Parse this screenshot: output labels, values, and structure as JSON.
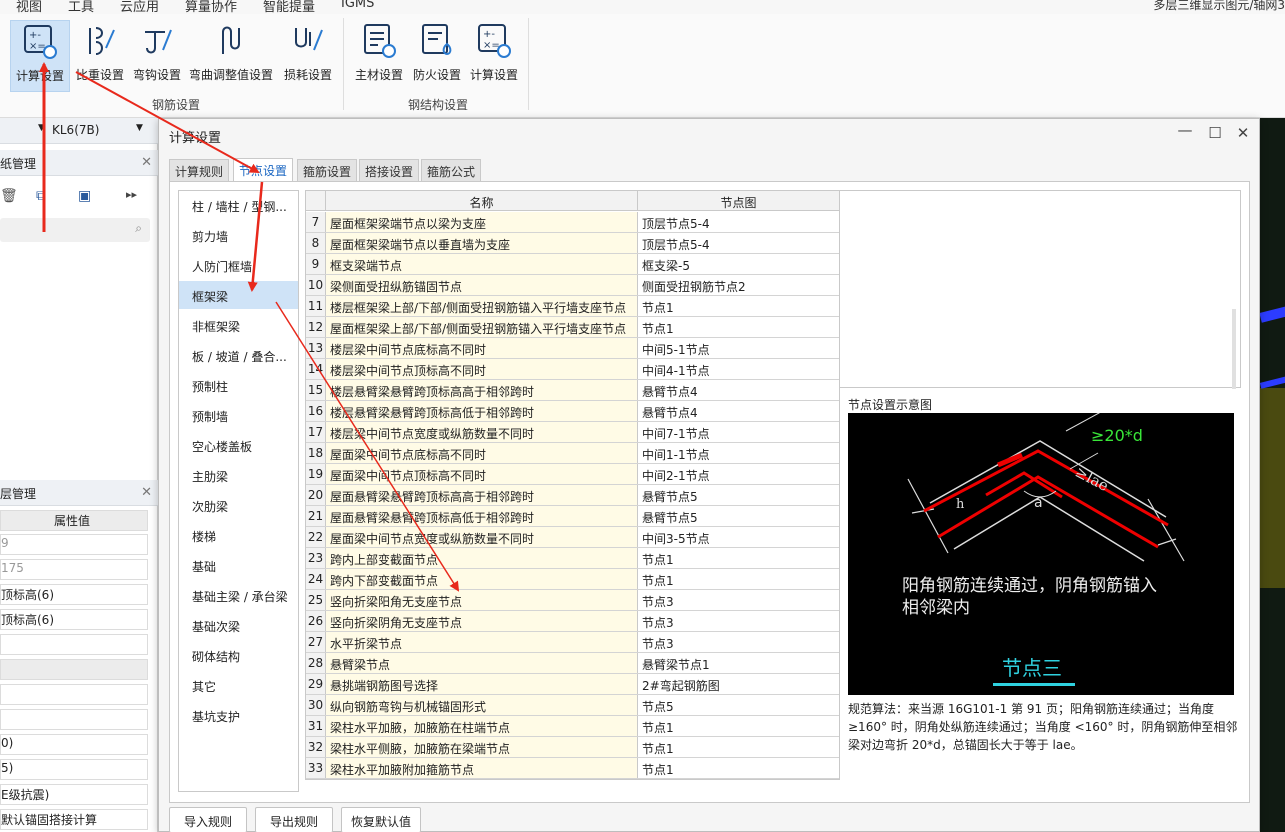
{
  "menu": [
    "视图",
    "工具",
    "云应用",
    "算量协作",
    "智能提量",
    "IGMS"
  ],
  "top_right": "多层三维显示图元/轴网3",
  "ribbon": {
    "rebar_buttons": [
      "计算设置",
      "比重设置",
      "弯钩设置",
      "弯曲调整值设置",
      "损耗设置"
    ],
    "rebar_group": "钢筋设置",
    "steel_buttons": [
      "主材设置",
      "防火设置",
      "计算设置"
    ],
    "steel_group": "钢结构设置"
  },
  "left_panel": {
    "kl_selector": "KL6(7B)",
    "drawing_mgmt": "纸管理",
    "layer_mgmt": "层管理",
    "prop_header": "属性值",
    "props": [
      "9",
      "175",
      "顶标高(6)",
      "顶标高(6)",
      "",
      "",
      "",
      "",
      "0)",
      "5)",
      "E级抗震)",
      "默认锚固搭接计算"
    ]
  },
  "dialog": {
    "title": "计算设置",
    "tabs": [
      "计算规则",
      "节点设置",
      "箍筋设置",
      "搭接设置",
      "箍筋公式"
    ],
    "categories": [
      "柱 / 墙柱 / 型钢...",
      "剪力墙",
      "人防门框墙",
      "框架梁",
      "非框架梁",
      "板 / 坡道 / 叠合...",
      "预制柱",
      "预制墙",
      "空心楼盖板",
      "主肋梁",
      "次肋梁",
      "楼梯",
      "基础",
      "基础主梁 / 承台梁",
      "基础次梁",
      "砌体结构",
      "其它",
      "基坑支护"
    ],
    "columns": [
      "名称",
      "节点图"
    ],
    "rows": [
      {
        "n": "7",
        "name": "屋面框架梁端节点以梁为支座",
        "node": "顶层节点5-4"
      },
      {
        "n": "8",
        "name": "屋面框架梁端节点以垂直墙为支座",
        "node": "顶层节点5-4"
      },
      {
        "n": "9",
        "name": "框支梁端节点",
        "node": "框支梁-5"
      },
      {
        "n": "10",
        "name": "梁侧面受扭纵筋锚固节点",
        "node": "侧面受扭钢筋节点2"
      },
      {
        "n": "11",
        "name": "楼层框架梁上部/下部/侧面受扭钢筋锚入平行墙支座节点",
        "node": "节点1"
      },
      {
        "n": "12",
        "name": "屋面框架梁上部/下部/侧面受扭钢筋锚入平行墙支座节点",
        "node": "节点1"
      },
      {
        "n": "13",
        "name": "楼层梁中间节点底标高不同时",
        "node": "中间5-1节点"
      },
      {
        "n": "14",
        "name": "楼层梁中间节点顶标高不同时",
        "node": "中间4-1节点"
      },
      {
        "n": "15",
        "name": "楼层悬臂梁悬臂跨顶标高高于相邻跨时",
        "node": "悬臂节点4"
      },
      {
        "n": "16",
        "name": "楼层悬臂梁悬臂跨顶标高低于相邻跨时",
        "node": "悬臂节点4"
      },
      {
        "n": "17",
        "name": "楼层梁中间节点宽度或纵筋数量不同时",
        "node": "中间7-1节点"
      },
      {
        "n": "18",
        "name": "屋面梁中间节点底标高不同时",
        "node": "中间1-1节点"
      },
      {
        "n": "19",
        "name": "屋面梁中间节点顶标高不同时",
        "node": "中间2-1节点"
      },
      {
        "n": "20",
        "name": "屋面悬臂梁悬臂跨顶标高高于相邻跨时",
        "node": "悬臂节点5"
      },
      {
        "n": "21",
        "name": "屋面悬臂梁悬臂跨顶标高低于相邻跨时",
        "node": "悬臂节点5"
      },
      {
        "n": "22",
        "name": "屋面梁中间节点宽度或纵筋数量不同时",
        "node": "中间3-5节点"
      },
      {
        "n": "23",
        "name": "跨内上部变截面节点",
        "node": "节点1"
      },
      {
        "n": "24",
        "name": "跨内下部变截面节点",
        "node": "节点1"
      },
      {
        "n": "25",
        "name": "竖向折梁阳角无支座节点",
        "node": "节点3"
      },
      {
        "n": "26",
        "name": "竖向折梁阴角无支座节点",
        "node": "节点3"
      },
      {
        "n": "27",
        "name": "水平折梁节点",
        "node": "节点3"
      },
      {
        "n": "28",
        "name": "悬臂梁节点",
        "node": "悬臂梁节点1"
      },
      {
        "n": "29",
        "name": "悬挑端钢筋图号选择",
        "node": "2#弯起钢筋图"
      },
      {
        "n": "30",
        "name": "纵向钢筋弯钩与机械锚固形式",
        "node": "节点5"
      },
      {
        "n": "31",
        "name": "梁柱水平加腋，加腋筋在柱端节点",
        "node": "节点1"
      },
      {
        "n": "32",
        "name": "梁柱水平侧腋，加腋筋在梁端节点",
        "node": "节点1"
      },
      {
        "n": "33",
        "name": "梁柱水平加腋附加箍筋节点",
        "node": "节点1"
      }
    ],
    "diagram_title": "节点设置示意图",
    "diagram": {
      "dim1": "≥20*d",
      "dim2": "≥lae",
      "h_label": "h",
      "a_label": "a",
      "text_line1": "阳角钢筋连续通过，阴角钢筋锚入",
      "text_line2": "相邻梁内",
      "node_name": "节点三"
    },
    "description": "规范算法：来当源 16G101-1 第 91 页；阳角钢筋连续通过；当角度≥160° 时，阴角处纵筋连续通过；当角度 <160° 时，阴角钢筋伸至相邻梁对边弯折 20*d，总锚固长大于等于 lae。",
    "buttons": [
      "导入规则",
      "导出规则",
      "恢复默认值"
    ]
  }
}
